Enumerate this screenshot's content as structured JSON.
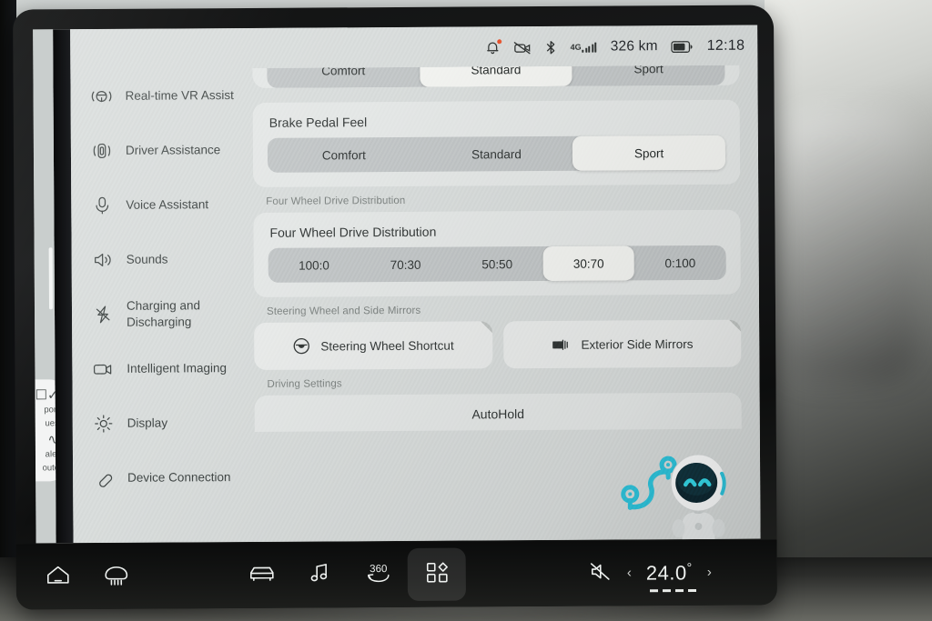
{
  "status_bar": {
    "notification_icon": "bell-icon",
    "notification_badge": true,
    "camera_off_icon": "camera-off-icon",
    "bluetooth_icon": "bluetooth-icon",
    "network_label": "4G",
    "signal_icon": "signal-bars-icon",
    "range": "326 km",
    "battery_icon": "battery-icon",
    "clock": "12:18"
  },
  "sidebar": {
    "items": [
      {
        "label": "Real-time VR Assist",
        "icon": "steering-wheel-vr-icon"
      },
      {
        "label": "Driver Assistance",
        "icon": "driver-assistance-icon"
      },
      {
        "label": "Voice Assistant",
        "icon": "microphone-icon"
      },
      {
        "label": "Sounds",
        "icon": "speaker-icon"
      },
      {
        "label": "Charging and Discharging",
        "icon": "lightning-bolt-icon"
      },
      {
        "label": "Intelligent Imaging",
        "icon": "camera-icon"
      },
      {
        "label": "Display",
        "icon": "brightness-sun-icon"
      },
      {
        "label": "Device Connection",
        "icon": "link-icon"
      }
    ]
  },
  "left_strip": {
    "card_icon": "report-icon",
    "card_line1": "port",
    "card_line2": "ues",
    "card_icon2": "route-icon",
    "card_line3": "alet",
    "card_line4": "oute"
  },
  "main": {
    "clipped_top_row": {
      "options": [
        "Comfort",
        "Standard",
        "Sport"
      ],
      "selected": "Standard"
    },
    "brake_pedal_feel": {
      "title": "Brake Pedal Feel",
      "options": [
        "Comfort",
        "Standard",
        "Sport"
      ],
      "selected": "Sport"
    },
    "four_wheel_drive": {
      "section_header": "Four Wheel Drive Distribution",
      "title": "Four Wheel Drive Distribution",
      "options": [
        "100:0",
        "70:30",
        "50:50",
        "30:70",
        "0:100"
      ],
      "selected": "30:70"
    },
    "steering_mirrors": {
      "section_header": "Steering Wheel and Side Mirrors",
      "cards": [
        {
          "label": "Steering Wheel Shortcut",
          "icon": "steering-wheel-icon"
        },
        {
          "label": "Exterior Side Mirrors",
          "icon": "side-mirror-icon"
        }
      ]
    },
    "driving_settings": {
      "section_header": "Driving Settings",
      "first_row_label": "AutoHold"
    }
  },
  "dock": {
    "buttons": [
      {
        "name": "home",
        "icon": "home-icon",
        "active": false
      },
      {
        "name": "defrost",
        "icon": "defrost-icon",
        "active": false
      },
      {
        "name": "car-controls",
        "icon": "car-icon",
        "active": false
      },
      {
        "name": "media",
        "icon": "music-note-icon",
        "active": false
      },
      {
        "name": "surround-view",
        "icon": "360-view-icon",
        "active": false
      },
      {
        "name": "apps",
        "icon": "app-grid-icon",
        "active": true
      }
    ],
    "mute_icon": "volume-mute-icon",
    "prev_icon": "chevron-left-icon",
    "next_icon": "chevron-right-icon",
    "temperature": "24.0",
    "degree_symbol": "°"
  },
  "colors": {
    "screen_bg": "#d7dbda",
    "segment_track": "#c0c4c5",
    "segment_selected": "#f2f3f0",
    "text_primary": "#2f3433",
    "text_secondary": "#7b817f",
    "accent_cyan": "#2ec4dd",
    "badge_red": "#e8502a",
    "dock_bg": "#141514"
  }
}
